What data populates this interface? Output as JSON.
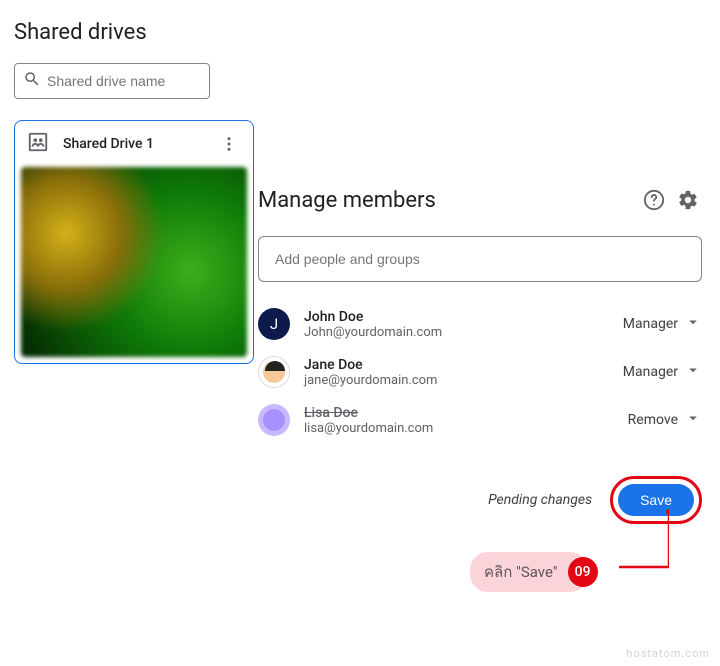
{
  "page_title": "Shared drives",
  "search": {
    "placeholder": "Shared drive name"
  },
  "drive_card": {
    "title": "Shared Drive 1"
  },
  "panel": {
    "title": "Manage members",
    "add_placeholder": "Add people and groups",
    "pending_text": "Pending changes",
    "save_label": "Save"
  },
  "members": [
    {
      "name": "John Doe",
      "email": "John@yourdomain.com",
      "role": "Manager",
      "removed": false,
      "initial": "J"
    },
    {
      "name": "Jane Doe",
      "email": "jane@yourdomain.com",
      "role": "Manager",
      "removed": false,
      "initial": ""
    },
    {
      "name": "Lisa Doe",
      "email": "lisa@yourdomain.com",
      "role": "Remove",
      "removed": true,
      "initial": ""
    }
  ],
  "callout": {
    "text": "คลิก \"Save\"",
    "badge": "09"
  },
  "watermark": "hostatom.com"
}
